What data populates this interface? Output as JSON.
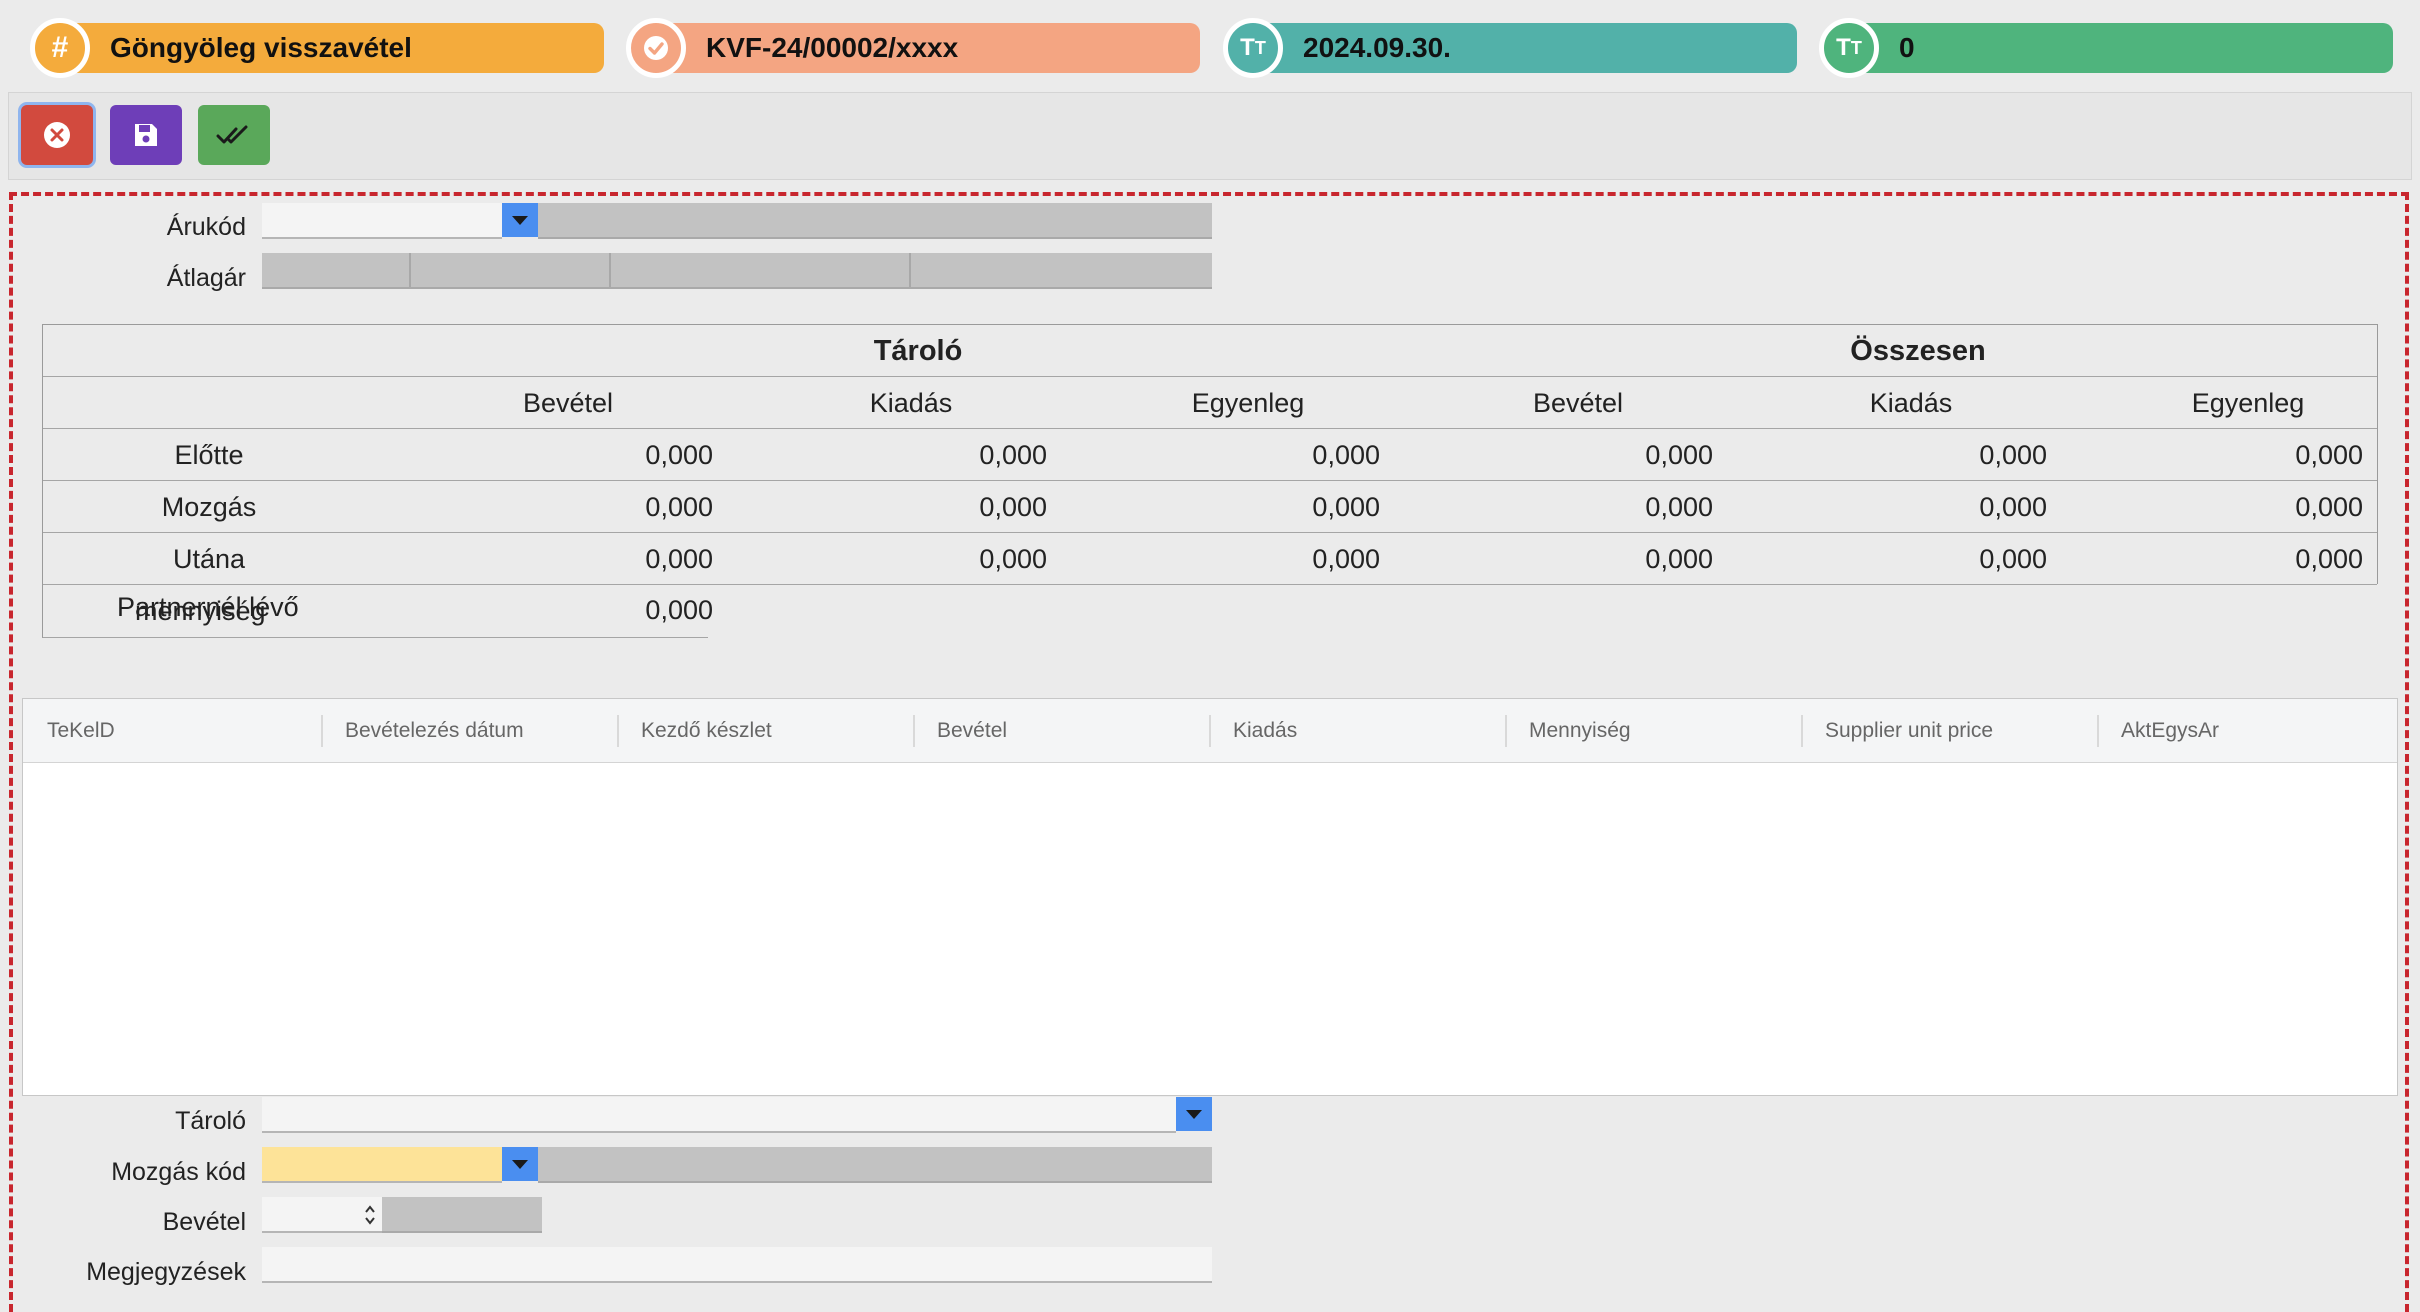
{
  "header": {
    "pills": [
      {
        "text": "Göngyöleg visszavétel",
        "icon": "hash-icon",
        "glyph": "#",
        "color": "#f4ab3c"
      },
      {
        "text": "KVF-24/00002/xxxx",
        "icon": "check-badge-icon",
        "glyph": "",
        "color": "#f4a582"
      },
      {
        "text": "2024.09.30.",
        "icon": "text-size-icon",
        "glyph": "TT",
        "color": "#52b1a9"
      },
      {
        "text": "0",
        "icon": "text-size-icon",
        "glyph": "TT",
        "color": "#4fb47d"
      }
    ]
  },
  "toolbar": {
    "buttons": [
      {
        "name": "cancel-button",
        "icon": "close-circle-icon",
        "color": "#d24a3e"
      },
      {
        "name": "save-button",
        "icon": "floppy-disk-icon",
        "color": "#6e3eb8"
      },
      {
        "name": "approve-button",
        "icon": "double-check-icon",
        "color": "#5aa85a"
      }
    ]
  },
  "form": {
    "arukod_label": "Árukód",
    "atlagar_label": "Átlagár"
  },
  "summary": {
    "group_headers": [
      "Tároló",
      "Összesen"
    ],
    "columns": [
      "Bevétel",
      "Kiadás",
      "Egyenleg",
      "Bevétel",
      "Kiadás",
      "Egyenleg"
    ],
    "rows": [
      {
        "label": "Előtte",
        "values": [
          "0,000",
          "0,000",
          "0,000",
          "0,000",
          "0,000",
          "0,000"
        ]
      },
      {
        "label": "Mozgás",
        "values": [
          "0,000",
          "0,000",
          "0,000",
          "0,000",
          "0,000",
          "0,000"
        ]
      },
      {
        "label": "Utána",
        "values": [
          "0,000",
          "0,000",
          "0,000",
          "0,000",
          "0,000",
          "0,000"
        ]
      }
    ],
    "extra_label_a": "Partnernél lévő",
    "extra_label_b": "mennyiség",
    "extra_value": "0,000"
  },
  "grid": {
    "columns": [
      "TeKelD",
      "Bevételezés dátum",
      "Kezdő készlet",
      "Bevétel",
      "Kiadás",
      "Mennyiség",
      "Supplier unit price",
      "AktEgysAr"
    ]
  },
  "bottom_form": {
    "tarolo_label": "Tároló",
    "mozgas_kod_label": "Mozgás kód",
    "bevetel_label": "Bevétel",
    "megjegyzesek_label": "Megjegyzések"
  },
  "colors": {
    "accent_blue": "#4a8ef0",
    "required_yellow": "#fde398",
    "dashed_border": "#c8262e"
  }
}
